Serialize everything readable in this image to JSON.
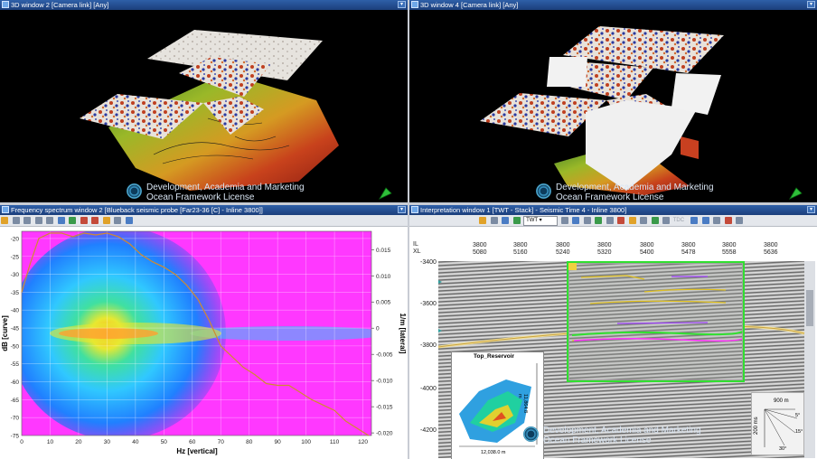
{
  "windows": {
    "w3d_left": {
      "title": "3D window 2 [Camera link] [Any]",
      "watermark_line1": "Development, Academia and Marketing",
      "watermark_line2": "Ocean Framework License"
    },
    "w3d_right": {
      "title": "3D window 4 [Camera link] [Any]",
      "watermark_line1": "Development, Academia and Marketing",
      "watermark_line2": "Ocean Framework License"
    },
    "spectrum": {
      "title": "Frequency spectrum window 2 [Blueback seismic probe [Far23-36 [C] - Inline 3800]]",
      "xlabel": "Hz [vertical]",
      "ylabel": "dB [curve]",
      "y2label": "1/m [lateral]"
    },
    "interp": {
      "title": "Interpretation window 1 [TWT - Stack] - Seismic Time 4 - Inline 3800]",
      "domain_select": "TWT",
      "il_label": "IL",
      "xl_label": "XL",
      "map_title": "Top_Reservoir",
      "map_scale": "12,038.0 m",
      "map_side": "11,864.8 m",
      "watermark_line1": "Development, Academia and Marketing",
      "watermark_line2": "Ocean Framework License",
      "scale_h": "900 m",
      "scale_v": "200 ms",
      "scale_a1": "5°",
      "scale_a2": "15°",
      "scale_a3": "30°",
      "tb_tdc": "TDC"
    }
  },
  "chart_data": [
    {
      "type": "heatmap",
      "title": "",
      "xlabel": "Hz [vertical]",
      "ylabel": "dB [curve]",
      "y2label": "1/m [lateral]",
      "xlim": [
        0,
        123
      ],
      "ylim": [
        -75,
        -18
      ],
      "y2lim": [
        -0.0205,
        0.0185
      ],
      "x_ticks": [
        0,
        10,
        20,
        30,
        40,
        50,
        60,
        70,
        80,
        90,
        100,
        110,
        120
      ],
      "y_ticks": [
        -20,
        -25,
        -30,
        -35,
        -40,
        -45,
        -50,
        -55,
        -60,
        -65,
        -70,
        -75
      ],
      "y2_ticks": [
        0.015,
        0.01,
        0.005,
        0,
        -0.005,
        -0.01,
        -0.015,
        -0.02
      ],
      "y2_tick_labels": [
        "0.015",
        "0.010",
        "0.005",
        "0",
        "-0.005",
        "-0.010",
        "-0.015",
        "-0.020"
      ],
      "curve": {
        "x": [
          0,
          3,
          6,
          10,
          14,
          18,
          22,
          26,
          30,
          34,
          38,
          42,
          46,
          50,
          54,
          58,
          62,
          66,
          70,
          74,
          78,
          82,
          86,
          90,
          94,
          98,
          102,
          106,
          110,
          114,
          118,
          122
        ],
        "y": [
          -35,
          -27,
          -20,
          -18.5,
          -18.5,
          -19.5,
          -18.5,
          -19,
          -18.5,
          -19.5,
          -21.5,
          -24.5,
          -26.5,
          -28,
          -30,
          -33,
          -37,
          -43,
          -50,
          -53,
          -56,
          -58,
          -60.5,
          -61,
          -61,
          -63,
          -65,
          -66.5,
          -68,
          -71,
          -73,
          -75
        ]
      }
    }
  ]
}
